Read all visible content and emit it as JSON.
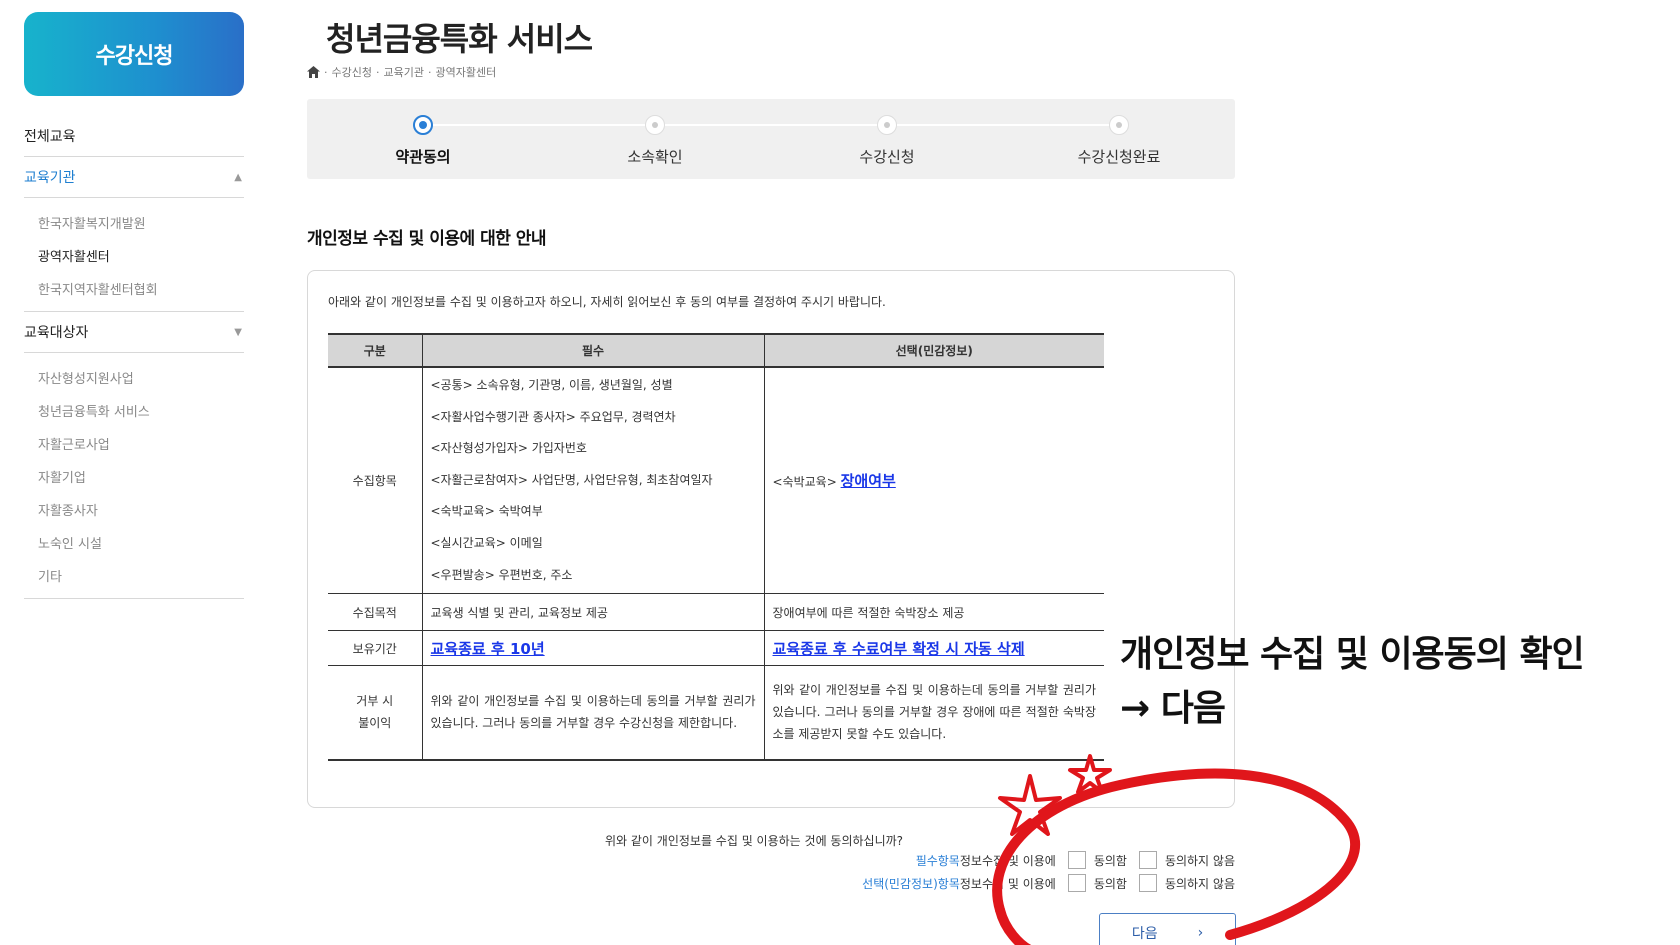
{
  "sidebar": {
    "enroll_button": "수강신청",
    "menu": [
      {
        "label": "전체교육"
      },
      {
        "label": "교육기관",
        "sub": [
          "한국자활복지개발원",
          "광역자활센터",
          "한국지역자활센터협회"
        ]
      },
      {
        "label": "교육대상자",
        "sub": [
          "자산형성지원사업",
          "청년금융특화 서비스",
          "자활근로사업",
          "자활기업",
          "자활종사자",
          "노숙인 시설",
          "기타"
        ]
      }
    ]
  },
  "page": {
    "title": "청년금융특화 서비스",
    "breadcrumb": [
      "수강신청",
      "교육기관",
      "광역자활센터"
    ]
  },
  "steps": [
    "약관동의",
    "소속확인",
    "수강신청",
    "수강신청완료"
  ],
  "section_title": "개인정보 수집 및 이용에 대한 안내",
  "intro": "아래와 같이 개인정보를 수집 및 이용하고자 하오니, 자세히 읽어보신 후 동의 여부를 결정하여 주시기 바랍니다.",
  "table": {
    "headers": [
      "구분",
      "필수",
      "선택(민감정보)"
    ],
    "collect_label": "수집항목",
    "collect_required": [
      "<공통> 소속유형, 기관명, 이름, 생년월일, 성별",
      "<자활사업수행기관 종사자> 주요업무, 경력연차",
      "<자산형성가입자> 가입자번호",
      "<자활근로참여자> 사업단명, 사업단유형, 최초참여일자",
      "<숙박교육> 숙박여부",
      "<실시간교육> 이메일",
      "<우편발송> 우편번호, 주소"
    ],
    "collect_optional_prefix": "<숙박교육> ",
    "collect_optional_link": "장애여부",
    "purpose_label": "수집목적",
    "purpose_required": "교육생 식별 및 관리, 교육정보 제공",
    "purpose_optional": "장애여부에 따른 적절한 숙박장소 제공",
    "retention_label": "보유기간",
    "retention_required": "교육종료 후 10년",
    "retention_optional": "교육종료 후 수료여부 확정 시 자동 삭제",
    "refuse_label_1": "거부 시",
    "refuse_label_2": "불이익",
    "refuse_required": "위와 같이 개인정보를 수집 및 이용하는데 동의를 거부할 권리가 있습니다. 그러나 동의를 거부할 경우 수강신청을 제한합니다.",
    "refuse_optional": "위와 같이 개인정보를 수집 및 이용하는데 동의를 거부할 권리가 있습니다. 그러나 동의를 거부할 경우 장애에 따른 적절한 숙박장소를 제공받지 못할 수도 있습니다."
  },
  "consent": {
    "question": "위와 같이 개인정보를 수집 및 이용하는 것에 동의하십니까?",
    "row1_blue": "필수항목",
    "row1_text": " 정보수집 및 이용에",
    "row2_blue": "선택(민감정보)항목",
    "row2_text": " 정보수집 및 이용에",
    "agree": "동의함",
    "disagree": "동의하지 않음"
  },
  "next_button": {
    "label": "다음",
    "arrow": "›"
  },
  "annotation": {
    "line1": "개인정보 수집 및 이용동의 확인",
    "line2": "→ 다음"
  }
}
